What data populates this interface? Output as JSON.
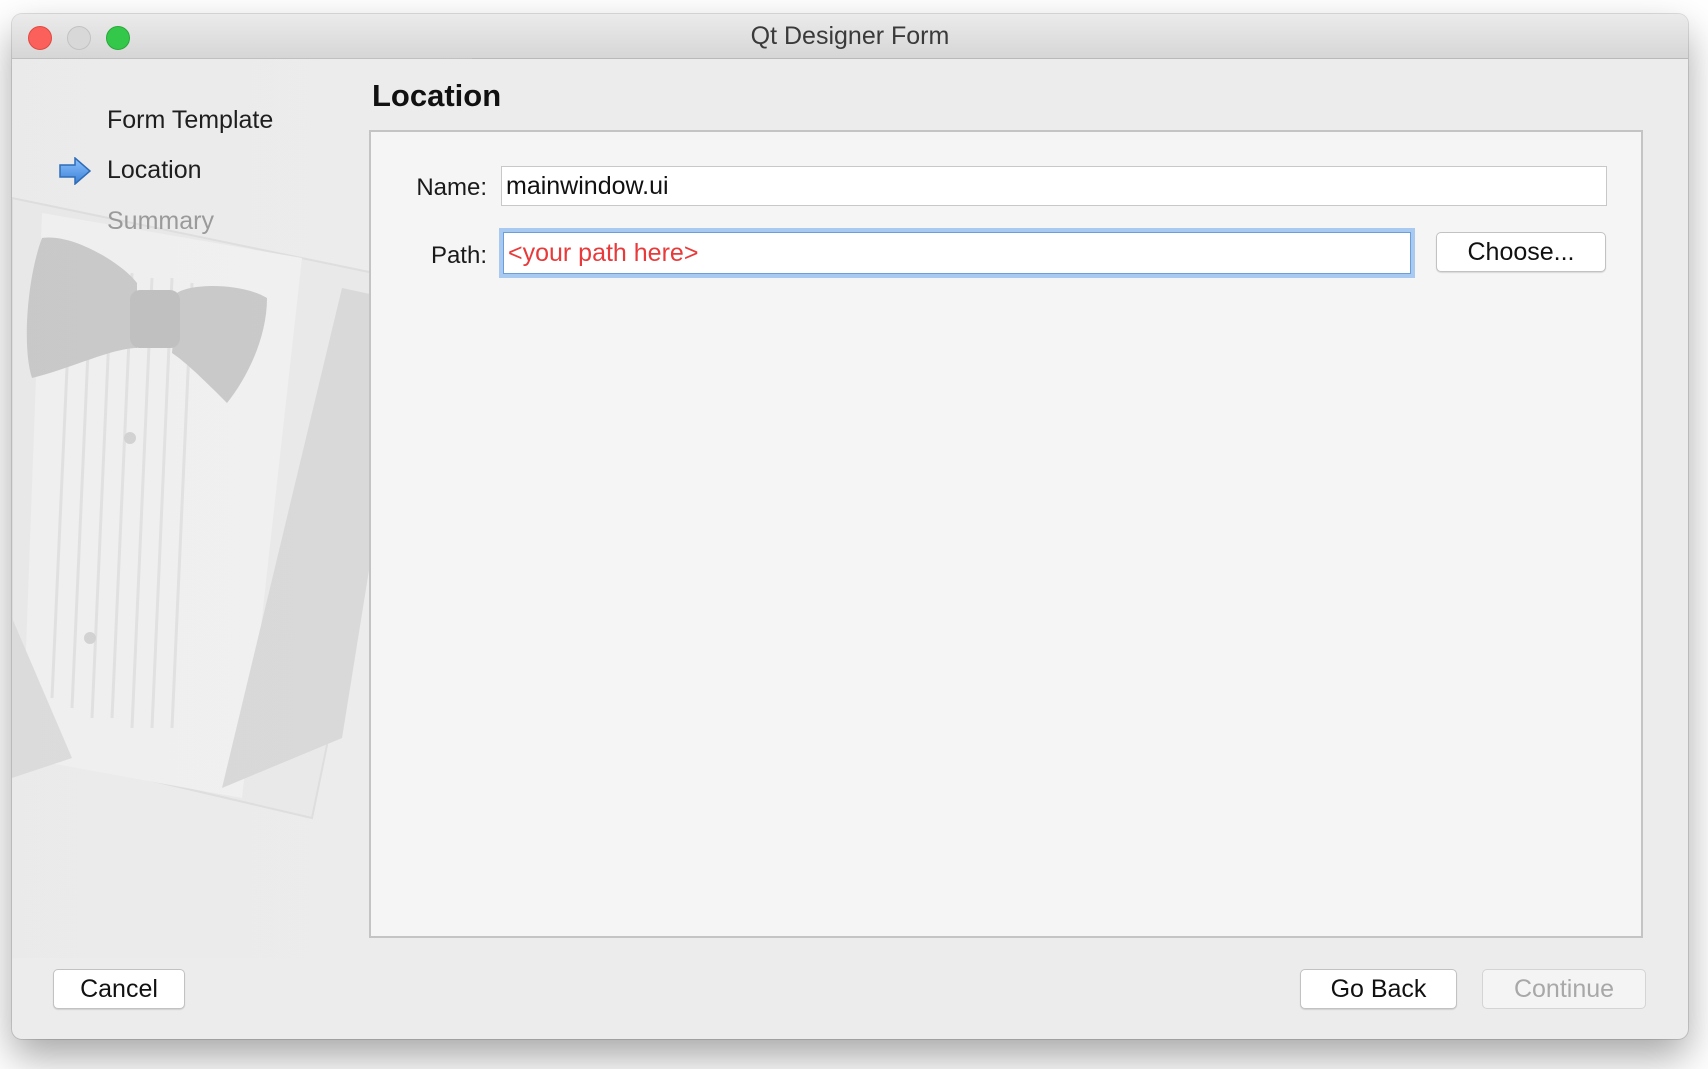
{
  "window": {
    "title": "Qt Designer Form"
  },
  "sidebar": {
    "items": [
      {
        "label": "Form Template",
        "state": "done"
      },
      {
        "label": "Location",
        "state": "current"
      },
      {
        "label": "Summary",
        "state": "pending"
      }
    ],
    "current_indicator_icon": "right-arrow-icon"
  },
  "main": {
    "title": "Location",
    "name_field": {
      "label": "Name:",
      "value": "mainwindow.ui"
    },
    "path_field": {
      "label": "Path:",
      "value": "<your path here>",
      "value_color": "#e83a3a"
    },
    "choose_button": "Choose..."
  },
  "footer": {
    "cancel_label": "Cancel",
    "back_label": "Go Back",
    "continue_label": "Continue",
    "continue_enabled": false
  },
  "colors": {
    "focus_ring": "#a8c9f0",
    "close": "#fc605b",
    "maximize": "#34c84a"
  }
}
